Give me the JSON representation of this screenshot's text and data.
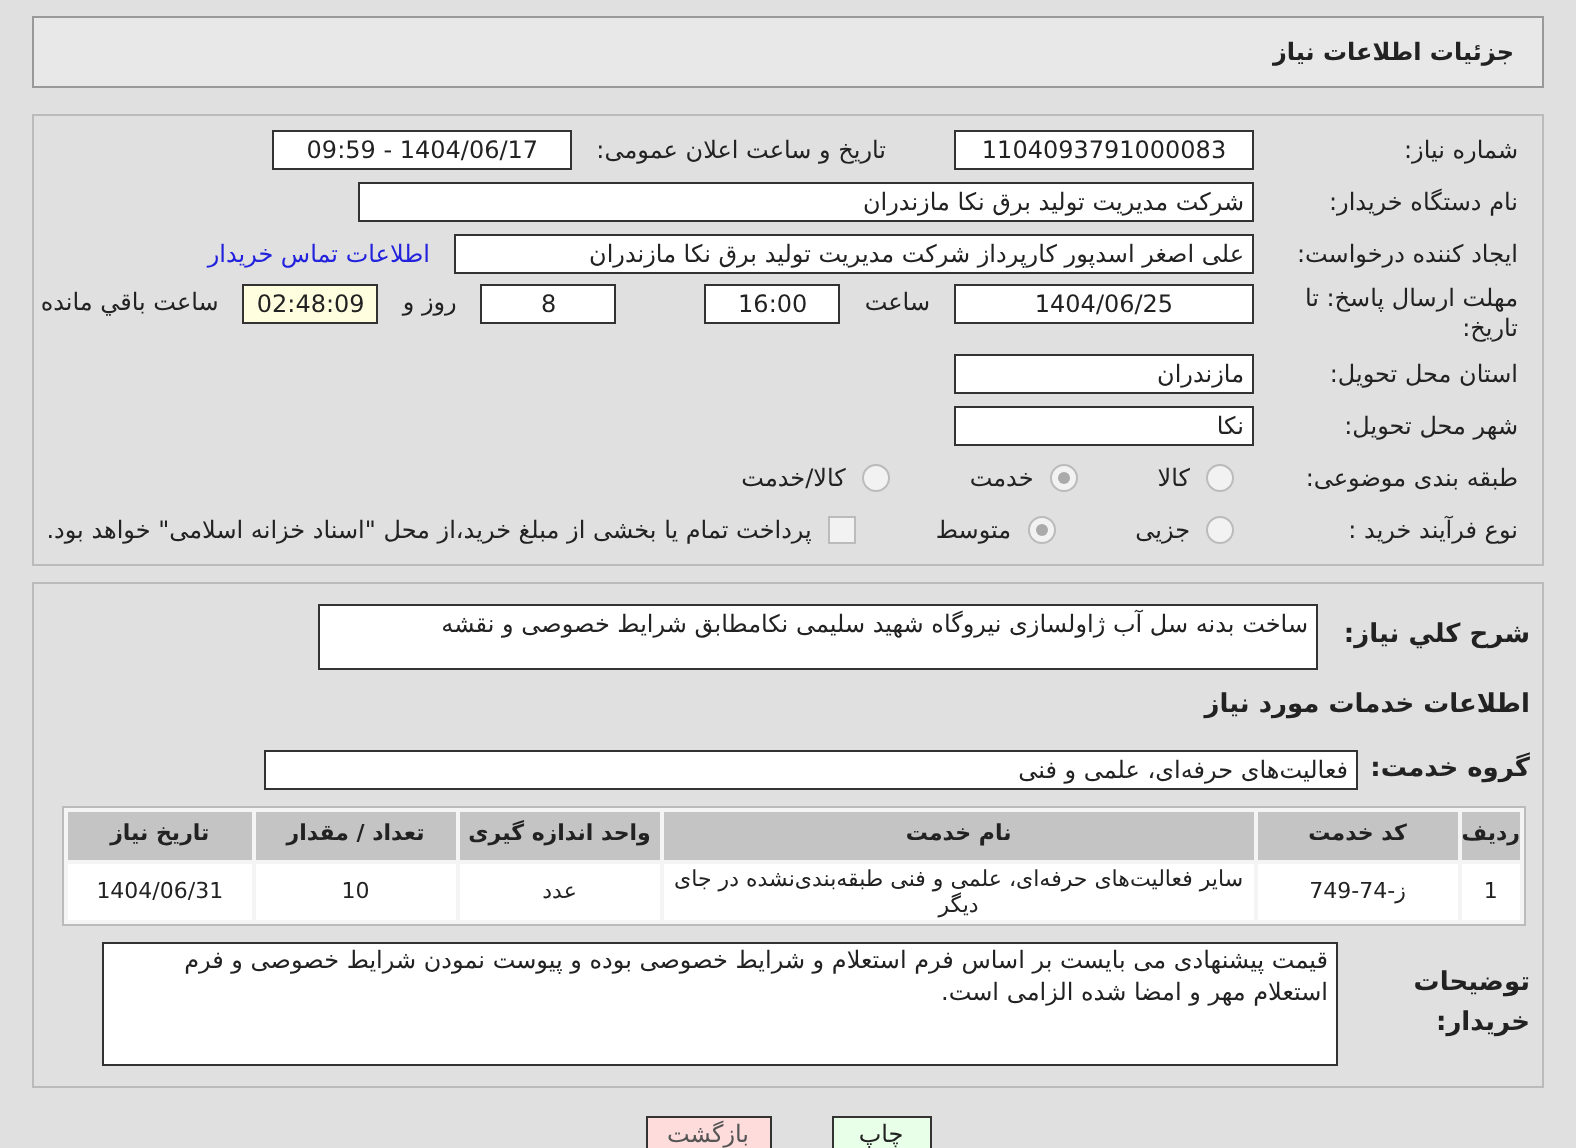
{
  "header": {
    "title": "جزئیات اطلاعات نیاز"
  },
  "need_number": {
    "label": "شماره نیاز:",
    "value": "1104093791000083"
  },
  "announce": {
    "label": "تاریخ و ساعت اعلان عمومی:",
    "value": "1404/06/17 - 09:59"
  },
  "buyer": {
    "label": "نام دستگاه خریدار:",
    "value": "شرکت مدیریت تولید برق نکا  مازندران"
  },
  "creator": {
    "label": "ایجاد کننده درخواست:",
    "value": "علی اصغر اسدپور کارپرداز شرکت مدیریت تولید برق نکا  مازندران",
    "link": "اطلاعات تماس خریدار"
  },
  "deadline": {
    "label": "مهلت ارسال پاسخ: تا تاریخ:",
    "date": "1404/06/25",
    "time_label": "ساعت",
    "time": "16:00",
    "days": "8",
    "days_label": "روز و",
    "remaining": "02:48:09",
    "remaining_label": "ساعت باقي مانده"
  },
  "province": {
    "label": "استان محل تحویل:",
    "value": "مازندران"
  },
  "city": {
    "label": "شهر محل تحویل:",
    "value": "نکا"
  },
  "category": {
    "label": "طبقه بندی موضوعی:",
    "options": [
      {
        "label": "کالا",
        "selected": false
      },
      {
        "label": "خدمت",
        "selected": true
      },
      {
        "label": "کالا/خدمت",
        "selected": false
      }
    ]
  },
  "process": {
    "label": "نوع فرآیند خرید :",
    "options": [
      {
        "label": "جزیی",
        "selected": false
      },
      {
        "label": "متوسط",
        "selected": true
      }
    ],
    "payment": {
      "label": "پرداخت تمام یا بخشی از مبلغ خرید،از محل \"اسناد خزانه اسلامی\" خواهد بود.",
      "checked": false
    }
  },
  "summary": {
    "label": "شرح کلي نياز:",
    "value": "ساخت بدنه سل آب ژاولسازی نیروگاه شهید سلیمی نکامطابق شرایط خصوصی و نقشه"
  },
  "services_title": "اطلاعات خدمات مورد نياز",
  "service_group": {
    "label": "گروه خدمت:",
    "value": "فعالیت‌های حرفه‌ای، علمی و فنی"
  },
  "table": {
    "columns": [
      "رديف",
      "کد خدمت",
      "نام خدمت",
      "واحد اندازه گیری",
      "تعداد / مقدار",
      "تاریخ نیاز"
    ],
    "rows": [
      [
        "1",
        "ز-74-749",
        "سایر فعالیت‌های حرفه‌ای، علمی و فنی طبقه‌بندی‌نشده در جای دیگر",
        "عدد",
        "10",
        "1404/06/31"
      ]
    ]
  },
  "notes": {
    "label": "توضیحات خریدار:",
    "value": "قیمت پیشنهادی می بایست بر اساس فرم استعلام و شرایط خصوصی بوده و پیوست نمودن شرایط خصوصی و فرم استعلام مهر و امضا شده الزامی است."
  },
  "buttons": [
    {
      "label": "چاپ",
      "kind": "print"
    },
    {
      "label": "بازگشت",
      "kind": "back"
    }
  ]
}
